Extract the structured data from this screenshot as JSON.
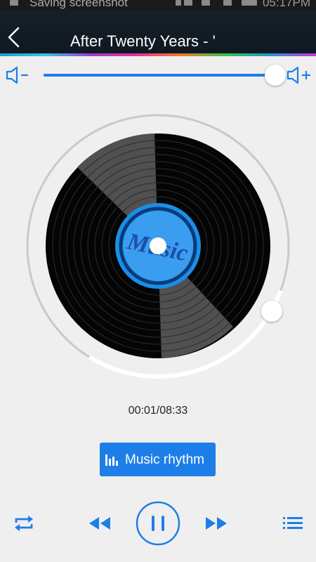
{
  "status_bar": {
    "notification": "Saving screenshot",
    "time": "05:17PM"
  },
  "header": {
    "title": "After Twenty Years - '"
  },
  "volume": {
    "level": 1.0
  },
  "player": {
    "time_display": "00:01/08:33",
    "disc_label": "Music",
    "progress": 0.002
  },
  "rhythm_button": {
    "label": "Music rhythm"
  },
  "controls": [
    "repeat-icon",
    "rewind-icon",
    "pause-icon",
    "fast-forward-icon",
    "playlist-icon"
  ],
  "colors": {
    "accent": "#1e7ee8",
    "background": "#efefef",
    "header": "#111a22"
  }
}
